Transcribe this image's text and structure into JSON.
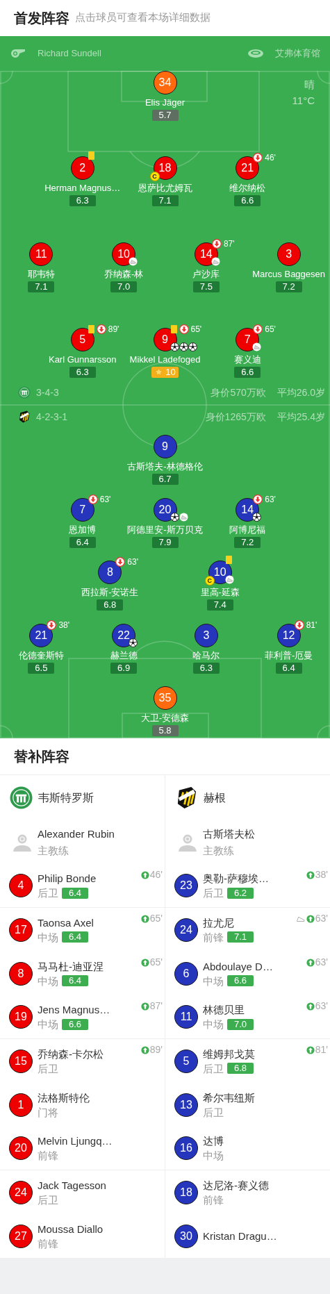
{
  "header": {
    "title": "首发阵容",
    "subtitle": "点击球员可查看本场详细数据"
  },
  "pitch": {
    "referee": "Richard Sundell",
    "venue": "艾弗体育馆",
    "weather": "晴",
    "temperature": "11°C",
    "home": {
      "color": "#ee0000",
      "formation": "3-4-3",
      "market_value": "身价570万欧",
      "average_age": "平均26.0岁",
      "lines": [
        {
          "players": [
            {
              "number": "34",
              "name": "Elis Jäger",
              "rating": "5.7",
              "best": false,
              "dimmed": true,
              "kind": "goalkeeper",
              "yellow_card": false
            }
          ]
        },
        {
          "players": [
            {
              "number": "2",
              "name": "Herman Magnus…",
              "rating": "6.3",
              "best": false,
              "dimmed": false,
              "kind": "outfield",
              "yellow_card": true
            },
            {
              "number": "18",
              "name": "恩萨比尤姆瓦",
              "rating": "7.1",
              "best": false,
              "dimmed": false,
              "kind": "outfield",
              "yellow_card": false,
              "captain_badge": "C"
            },
            {
              "number": "21",
              "name": "维尔纳松",
              "rating": "6.6",
              "best": false,
              "dimmed": false,
              "kind": "outfield",
              "yellow_card": false,
              "sub_out": "46'"
            }
          ]
        },
        {
          "players": [
            {
              "number": "11",
              "name": "耶韦特",
              "rating": "7.1",
              "best": false,
              "dimmed": false,
              "kind": "outfield",
              "yellow_card": false
            },
            {
              "number": "10",
              "name": "乔纳森-林",
              "rating": "7.0",
              "best": false,
              "dimmed": false,
              "kind": "outfield",
              "yellow_card": false,
              "events": [
                {
                  "kind": "assist"
                }
              ]
            },
            {
              "number": "14",
              "name": "卢沙库",
              "rating": "7.5",
              "best": false,
              "dimmed": false,
              "kind": "outfield",
              "yellow_card": false,
              "sub_out": "87'",
              "events": [
                {
                  "kind": "assist"
                }
              ]
            },
            {
              "number": "3",
              "name": "Marcus Baggesen",
              "rating": "7.2",
              "best": false,
              "dimmed": false,
              "kind": "outfield",
              "yellow_card": false
            }
          ]
        },
        {
          "players": [
            {
              "number": "5",
              "name": "Karl Gunnarsson",
              "rating": "6.3",
              "best": false,
              "dimmed": false,
              "kind": "outfield",
              "yellow_card": true,
              "sub_out": "89'"
            },
            {
              "number": "9",
              "name": "Mikkel Ladefoged",
              "rating": "10",
              "best": true,
              "dimmed": false,
              "kind": "outfield",
              "yellow_card": true,
              "sub_out": "65'",
              "events": [
                {
                  "kind": "goal"
                },
                {
                  "kind": "goal"
                },
                {
                  "kind": "goal"
                }
              ]
            },
            {
              "number": "7",
              "name": "赛义迪",
              "rating": "6.6",
              "best": false,
              "dimmed": false,
              "kind": "outfield",
              "yellow_card": false,
              "sub_out": "65'",
              "events": [
                {
                  "kind": "assist"
                }
              ]
            }
          ]
        }
      ]
    },
    "away": {
      "color": "#2536bd",
      "formation": "4-2-3-1",
      "market_value": "身价1265万欧",
      "average_age": "平均25.4岁",
      "lines": [
        {
          "players": [
            {
              "number": "9",
              "name": "古斯塔夫-林德格伦",
              "rating": "6.7",
              "best": false,
              "dimmed": false,
              "kind": "outfield",
              "yellow_card": false
            }
          ]
        },
        {
          "players": [
            {
              "number": "7",
              "name": "恩加博",
              "rating": "6.4",
              "best": false,
              "dimmed": false,
              "kind": "outfield",
              "yellow_card": false,
              "sub_out": "63'"
            },
            {
              "number": "20",
              "name": "阿德里安-斯万贝克",
              "rating": "7.9",
              "best": false,
              "dimmed": false,
              "kind": "outfield",
              "yellow_card": false,
              "events": [
                {
                  "kind": "goal"
                },
                {
                  "kind": "assist"
                }
              ]
            },
            {
              "number": "14",
              "name": "阿博尼福",
              "rating": "7.2",
              "best": false,
              "dimmed": false,
              "kind": "outfield",
              "yellow_card": false,
              "sub_out": "63'",
              "events": [
                {
                  "kind": "goal"
                }
              ]
            }
          ]
        },
        {
          "players": [
            {
              "number": "8",
              "name": "西拉斯-安诺生",
              "rating": "6.8",
              "best": false,
              "dimmed": false,
              "kind": "outfield",
              "yellow_card": false,
              "sub_out": "63'"
            },
            {
              "number": "10",
              "name": "里高-延森",
              "rating": "7.4",
              "best": false,
              "dimmed": false,
              "kind": "outfield",
              "yellow_card": true,
              "captain_badge": "C",
              "events": [
                {
                  "kind": "assist"
                }
              ]
            }
          ]
        },
        {
          "players": [
            {
              "number": "21",
              "name": "伦德奎斯特",
              "rating": "6.5",
              "best": false,
              "dimmed": false,
              "kind": "outfield",
              "yellow_card": false,
              "sub_out": "38'"
            },
            {
              "number": "22",
              "name": "赫兰德",
              "rating": "6.9",
              "best": false,
              "dimmed": false,
              "kind": "outfield",
              "yellow_card": false,
              "events": [
                {
                  "kind": "goal"
                }
              ]
            },
            {
              "number": "3",
              "name": "哈马尔",
              "rating": "6.3",
              "best": false,
              "dimmed": false,
              "kind": "outfield",
              "yellow_card": false
            },
            {
              "number": "12",
              "name": "菲利普-厄曼",
              "rating": "6.4",
              "best": false,
              "dimmed": false,
              "kind": "outfield",
              "yellow_card": false,
              "sub_out": "81'"
            }
          ]
        },
        {
          "players": [
            {
              "number": "35",
              "name": "大卫-安德森",
              "rating": "5.8",
              "best": false,
              "dimmed": true,
              "kind": "goalkeeper",
              "yellow_card": false
            }
          ]
        }
      ]
    }
  },
  "substitutes": {
    "title": "替补阵容",
    "home": {
      "team": "韦斯特罗斯",
      "coach": {
        "name": "Alexander Rubin",
        "role": "主教练"
      },
      "players": [
        {
          "number": "4",
          "name": "Philip Bonde",
          "position": "后卫",
          "rating": "6.4",
          "sub_in": "46'",
          "divider_below": true
        },
        {
          "number": "17",
          "name": "Taonsa Axel",
          "position": "中场",
          "rating": "6.4",
          "sub_in": "65'",
          "divider_below": false
        },
        {
          "number": "8",
          "name": "马马杜-迪亚涅",
          "position": "中场",
          "rating": "6.4",
          "sub_in": "65'",
          "divider_below": false
        },
        {
          "number": "19",
          "name": "Jens Magnus…",
          "position": "中场",
          "rating": "6.6",
          "sub_in": "87'",
          "divider_below": true
        },
        {
          "number": "15",
          "name": "乔纳森-卡尔松",
          "position": "后卫",
          "sub_in": "89'",
          "divider_below": false
        },
        {
          "number": "1",
          "name": "法格斯特伦",
          "position": "门将",
          "divider_below": false
        },
        {
          "number": "20",
          "name": "Melvin Ljungq…",
          "position": "前锋",
          "divider_below": true
        },
        {
          "number": "24",
          "name": "Jack Tagesson",
          "position": "后卫",
          "divider_below": false
        },
        {
          "number": "27",
          "name": "Moussa Diallo",
          "position": "前锋",
          "divider_below": false
        }
      ]
    },
    "away": {
      "team": "赫根",
      "coach": {
        "name": "古斯塔夫松",
        "role": "主教练"
      },
      "players": [
        {
          "number": "23",
          "name": "奥勒-萨穆埃…",
          "position": "后卫",
          "rating": "6.2",
          "sub_in": "38'",
          "divider_below": true
        },
        {
          "number": "24",
          "name": "拉尤尼",
          "position": "前锋",
          "rating": "7.1",
          "sub_in": "63'",
          "events": [
            {
              "kind": "assist"
            }
          ],
          "divider_below": false
        },
        {
          "number": "6",
          "name": "Abdoulaye D…",
          "position": "中场",
          "rating": "6.6",
          "sub_in": "63'",
          "divider_below": false
        },
        {
          "number": "11",
          "name": "林德贝里",
          "position": "中场",
          "rating": "7.0",
          "sub_in": "63'",
          "divider_below": true
        },
        {
          "number": "5",
          "name": "维姆邦戈莫",
          "position": "后卫",
          "rating": "6.8",
          "sub_in": "81'",
          "divider_below": false
        },
        {
          "number": "13",
          "name": "希尔韦纽斯",
          "position": "后卫",
          "divider_below": false
        },
        {
          "number": "16",
          "name": "达博",
          "position": "中场",
          "divider_below": true
        },
        {
          "number": "18",
          "name": "达尼洛-赛义德",
          "position": "前锋",
          "divider_below": false
        },
        {
          "number": "30",
          "name": "Kristan Dragu…",
          "divider_below": false
        }
      ]
    }
  }
}
